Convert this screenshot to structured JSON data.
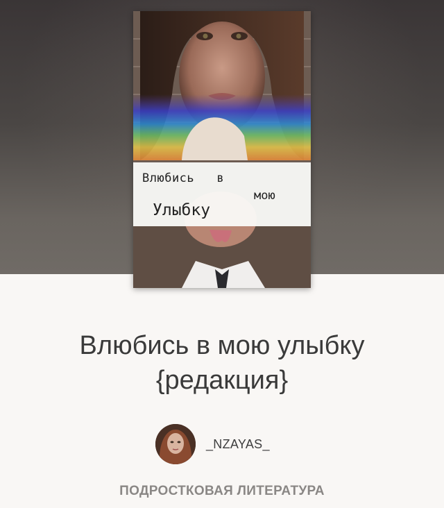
{
  "cover": {
    "line1": "Влюбись   в",
    "line2": "мою",
    "line3": "Улыбку"
  },
  "book": {
    "title_line1": "Влюбись в мою улыбку",
    "title_line2": "{редакция}"
  },
  "author": {
    "name": "_NZAYAS_"
  },
  "genre": "ПОДРОСТКОВАЯ ЛИТЕРАТУРА",
  "colors": {
    "hero_top": "#3a3536",
    "hero_bottom": "#706b66",
    "page_bg": "#f9f7f5",
    "title_text": "#3a3a3a",
    "genre_text": "#8a8785"
  }
}
